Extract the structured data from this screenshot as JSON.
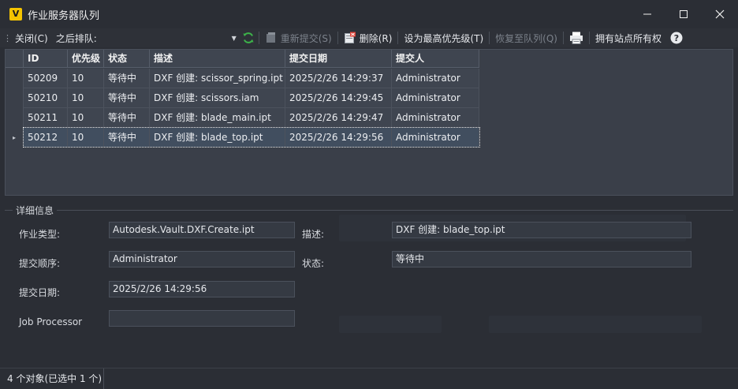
{
  "window": {
    "title": "作业服务器队列",
    "app_icon_letter": "V",
    "minimize_icon": "minimize-icon",
    "maximize_icon": "maximize-icon",
    "close_icon": "close-icon"
  },
  "toolbar": {
    "close_label": "关闭(C)",
    "after_queue_label": "之后排队:",
    "refresh_icon": "refresh-icon",
    "resubmit_label": "重新提交(S)",
    "delete_label": "删除(R)",
    "highest_priority_label": "设为最高优先级(T)",
    "restore_queue_label": "恢复至队列(Q)",
    "print_icon": "print-icon",
    "own_all_label": "拥有站点所有权",
    "help_icon": "help-icon",
    "accent_green": "#3db34a",
    "accent_red": "#e0443a"
  },
  "grid": {
    "columns": [
      "ID",
      "优先级",
      "状态",
      "描述",
      "提交日期",
      "提交人"
    ],
    "rows": [
      {
        "id": "50209",
        "priority": "10",
        "status": "等待中",
        "description": "DXF 创建: scissor_spring.ipt",
        "date": "2025/2/26 14:29:37",
        "submitter": "Administrator",
        "selected": false
      },
      {
        "id": "50210",
        "priority": "10",
        "status": "等待中",
        "description": "DXF 创建: scissors.iam",
        "date": "2025/2/26 14:29:45",
        "submitter": "Administrator",
        "selected": false
      },
      {
        "id": "50211",
        "priority": "10",
        "status": "等待中",
        "description": "DXF 创建: blade_main.ipt",
        "date": "2025/2/26 14:29:47",
        "submitter": "Administrator",
        "selected": false
      },
      {
        "id": "50212",
        "priority": "10",
        "status": "等待中",
        "description": "DXF 创建: blade_top.ipt",
        "date": "2025/2/26 14:29:56",
        "submitter": "Administrator",
        "selected": true
      }
    ]
  },
  "details": {
    "legend": "详细信息",
    "job_type_label": "作业类型:",
    "job_type_value": "Autodesk.Vault.DXF.Create.ipt",
    "description_label": "描述:",
    "description_value": "DXF 创建: blade_top.ipt",
    "submit_order_label": "提交顺序:",
    "submit_order_value": "Administrator",
    "status_label": "状态:",
    "status_value": "等待中",
    "submit_date_label": "提交日期:",
    "submit_date_value": "2025/2/26 14:29:56",
    "job_processor_label": "Job Processor",
    "job_processor_value": ""
  },
  "statusbar": {
    "text": "4 个对象(已选中 1 个)"
  }
}
